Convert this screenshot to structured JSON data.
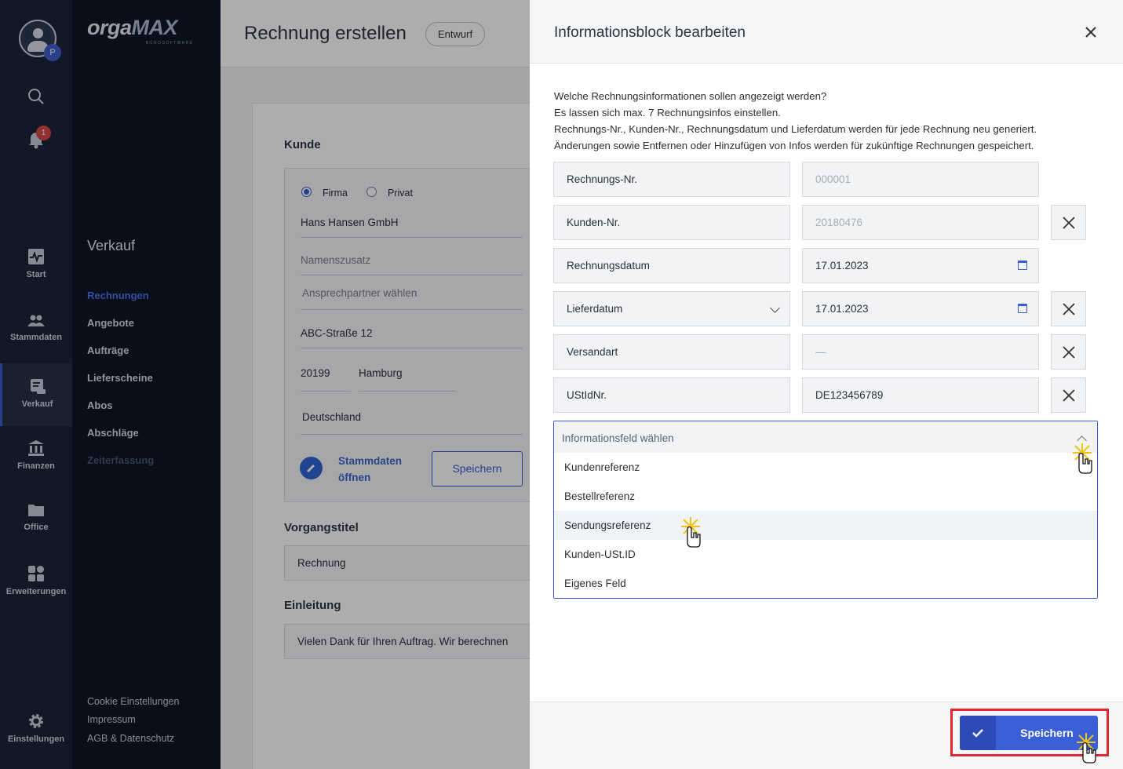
{
  "rail": {
    "avatar_initial": "P",
    "notification_count": "1",
    "items": [
      {
        "label": "Start",
        "icon": "pulse-icon"
      },
      {
        "label": "Stammdaten",
        "icon": "users-icon"
      },
      {
        "label": "Verkauf",
        "icon": "receipt-icon"
      },
      {
        "label": "Finanzen",
        "icon": "bank-icon"
      },
      {
        "label": "Office",
        "icon": "folder-icon"
      },
      {
        "label": "Erweiterungen",
        "icon": "puzzle-icon"
      },
      {
        "label": "Einstellungen",
        "icon": "gear-icon"
      }
    ]
  },
  "nav": {
    "logo_main": "orga",
    "logo_accent": "MAX",
    "logo_sub": "BÜROSOFTWARE",
    "section_title": "Verkauf",
    "links": [
      "Rechnungen",
      "Angebote",
      "Aufträge",
      "Lieferscheine",
      "Abos",
      "Abschläge",
      "Zeiterfassung"
    ],
    "footer": [
      "Cookie Einstellungen",
      "Impressum",
      "AGB & Datenschutz"
    ]
  },
  "page": {
    "title": "Rechnung erstellen",
    "status": "Entwurf",
    "kunde_heading": "Kunde",
    "radio_firma": "Firma",
    "radio_privat": "Privat",
    "company": "Hans Hansen GmbH",
    "name_suffix_placeholder": "Namenszusatz",
    "contact_placeholder": "Ansprechpartner wählen",
    "street": "ABC-Straße 12",
    "zip": "20199",
    "city": "Hamburg",
    "country": "Deutschland",
    "stammdaten_link_1": "Stammdaten",
    "stammdaten_link_2": "öffnen",
    "save_label": "Speichern",
    "vorgangstitel_heading": "Vorgangstitel",
    "vorgangstitel_value": "Rechnung",
    "einleitung_heading": "Einleitung",
    "einleitung_value": "Vielen Dank für Ihren Auftrag. Wir berechnen"
  },
  "drawer": {
    "title": "Informationsblock bearbeiten",
    "intro": [
      "Welche Rechnungsinformationen sollen angezeigt werden?",
      "Es lassen sich max. 7 Rechnungsinfos einstellen.",
      "Rechnungs-Nr., Kunden-Nr., Rechnungsdatum und Lieferdatum werden für jede Rechnung neu generiert.",
      "Änderungen sowie Entfernen oder Hinzufügen von Infos werden für zukünftige Rechnungen gespeichert."
    ],
    "rows": [
      {
        "label": "Rechnungs-Nr.",
        "value": "000001"
      },
      {
        "label": "Kunden-Nr.",
        "value": "20180476"
      },
      {
        "label": "Rechnungsdatum",
        "value": "17.01.2023"
      },
      {
        "label": "Lieferdatum",
        "value": "17.01.2023"
      },
      {
        "label": "Versandart",
        "value": "—"
      },
      {
        "label": "UStIdNr.",
        "value": "DE123456789"
      }
    ],
    "dropdown": {
      "placeholder": "Informationsfeld wählen",
      "options": [
        "Kundenreferenz",
        "Bestellreferenz",
        "Sendungsreferenz",
        "Kunden-USt.ID",
        "Eigenes Feld"
      ]
    },
    "save_label": "Speichern"
  },
  "colors": {
    "accent": "#3b5fd6",
    "highlight_frame": "#e32530",
    "rail_bg": "#1b2437",
    "nav_bg": "#0f1628"
  }
}
